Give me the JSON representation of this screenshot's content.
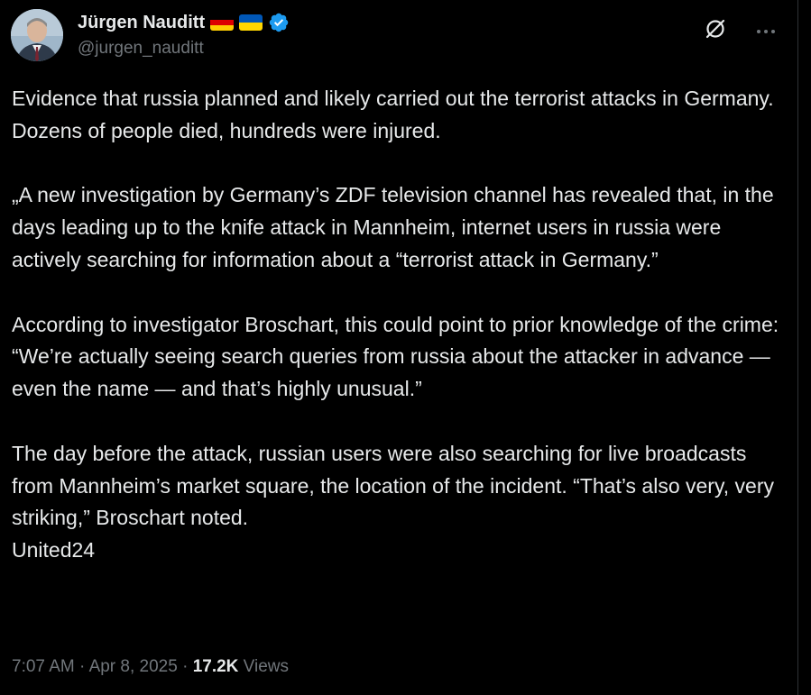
{
  "author": {
    "display_name": "Jürgen Nauditt",
    "handle": "@jurgen_nauditt",
    "flags": [
      "germany-flag",
      "ukraine-flag"
    ],
    "verified": true
  },
  "icons": {
    "grok": "grok-icon",
    "more": "more-icon",
    "verified": "verified-badge-icon"
  },
  "colors": {
    "background": "#000000",
    "text": "#e7e9ea",
    "secondary": "#71767b",
    "verified": "#1d9bf0"
  },
  "tweet": {
    "paragraphs": [
      "Evidence that russia planned and likely carried out the terrorist attacks in Germany.\nDozens of people died, hundreds were injured.",
      "„A new investigation by Germany’s ZDF television channel has revealed that, in the days leading up to the knife attack in Mannheim, internet users in russia were actively searching for information about a “terrorist attack in Germany.”",
      "According to investigator Broschart, this could point to prior knowledge of the crime: “We’re actually seeing search queries from russia about the attacker in advance — even the name — and that’s highly unusual.”",
      "The day before the attack, russian users were also searching for live broadcasts from Mannheim’s market square, the location of the incident. “That’s also very, very striking,” Broschart noted.\nUnited24"
    ]
  },
  "meta": {
    "time": "7:07 AM",
    "separator": " · ",
    "date": "Apr 8, 2025",
    "views_count": "17.2K",
    "views_label": " Views"
  }
}
